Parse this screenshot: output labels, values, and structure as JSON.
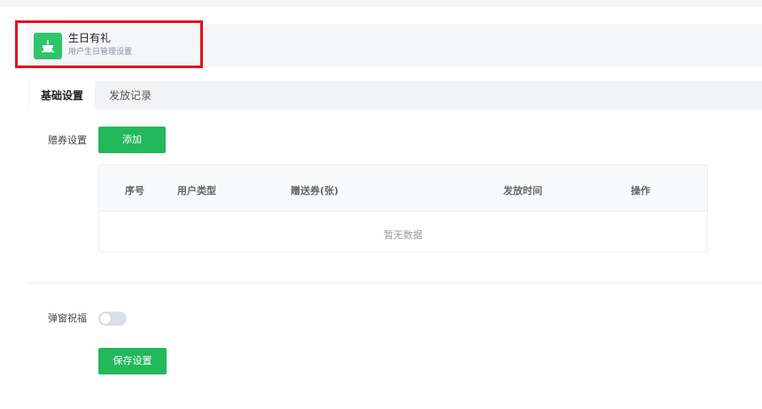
{
  "header": {
    "title": "生日有礼",
    "subtitle": "用户生日管理设置",
    "icon": "birthday-cake-icon",
    "icon_color": "#2fc56a",
    "highlight_color": "#e0141e"
  },
  "tabs": [
    {
      "label": "基础设置",
      "active": true
    },
    {
      "label": "发放记录",
      "active": false
    }
  ],
  "coupon_setting": {
    "label": "赠券设置",
    "add_button": "添加"
  },
  "table": {
    "columns": [
      "序号",
      "用户类型",
      "赠送券(张)",
      "发放时间",
      "操作"
    ],
    "rows": [],
    "empty_text": "暂无数据"
  },
  "popup_greeting": {
    "label": "弹窗祝福",
    "enabled": false
  },
  "save_button": "保存设置",
  "accent_color": "#22b85c"
}
